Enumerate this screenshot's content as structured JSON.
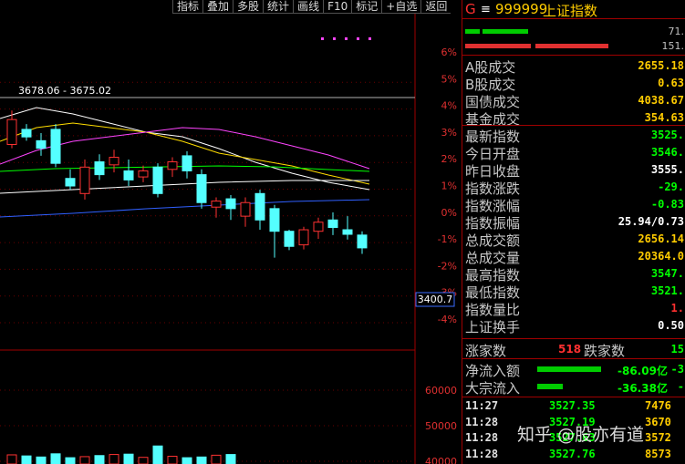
{
  "toolbar": [
    "指标",
    "叠加",
    "多股",
    "统计",
    "画线",
    "F10",
    "标记",
    "+自选",
    "返回"
  ],
  "chart": {
    "pct_axis": [
      "6%",
      "5%",
      "4%",
      "3%",
      "2%",
      "1%",
      "0%",
      "-1%",
      "-2%",
      "-3%",
      "-4%"
    ],
    "vol_axis": [
      "60000",
      "50000",
      "40000"
    ],
    "price_label": "3678.06 - 3675.02",
    "cursor_price": "3400.7",
    "candles": [
      {
        "o": 3645,
        "c": 3678,
        "h": 3690,
        "l": 3640
      },
      {
        "o": 3665,
        "c": 3655,
        "h": 3672,
        "l": 3650
      },
      {
        "o": 3650,
        "c": 3640,
        "h": 3660,
        "l": 3630
      },
      {
        "o": 3665,
        "c": 3620,
        "h": 3672,
        "l": 3615
      },
      {
        "o": 3600,
        "c": 3590,
        "h": 3612,
        "l": 3585
      },
      {
        "o": 3580,
        "c": 3615,
        "h": 3625,
        "l": 3572
      },
      {
        "o": 3622,
        "c": 3605,
        "h": 3632,
        "l": 3598
      },
      {
        "o": 3618,
        "c": 3628,
        "h": 3638,
        "l": 3608
      },
      {
        "o": 3610,
        "c": 3598,
        "h": 3625,
        "l": 3590
      },
      {
        "o": 3602,
        "c": 3610,
        "h": 3617,
        "l": 3595
      },
      {
        "o": 3615,
        "c": 3580,
        "h": 3620,
        "l": 3575
      },
      {
        "o": 3612,
        "c": 3622,
        "h": 3628,
        "l": 3602
      },
      {
        "o": 3630,
        "c": 3610,
        "h": 3636,
        "l": 3600
      },
      {
        "o": 3605,
        "c": 3568,
        "h": 3612,
        "l": 3560
      },
      {
        "o": 3562,
        "c": 3570,
        "h": 3575,
        "l": 3548
      },
      {
        "o": 3573,
        "c": 3560,
        "h": 3578,
        "l": 3545
      },
      {
        "o": 3550,
        "c": 3568,
        "h": 3575,
        "l": 3536
      },
      {
        "o": 3580,
        "c": 3545,
        "h": 3585,
        "l": 3532
      },
      {
        "o": 3560,
        "c": 3530,
        "h": 3565,
        "l": 3495
      },
      {
        "o": 3530,
        "c": 3510,
        "h": 3532,
        "l": 3505
      },
      {
        "o": 3512,
        "c": 3532,
        "h": 3536,
        "l": 3506
      },
      {
        "o": 3530,
        "c": 3542,
        "h": 3548,
        "l": 3520
      },
      {
        "o": 3545,
        "c": 3535,
        "h": 3555,
        "l": 3525
      },
      {
        "o": 3532,
        "c": 3526,
        "h": 3550,
        "l": 3519
      },
      {
        "o": 3525,
        "c": 3508,
        "h": 3530,
        "l": 3500
      }
    ],
    "vol_bars": [
      41800,
      41500,
      41200,
      42100,
      41000,
      41300,
      41600,
      41900,
      42000,
      41100,
      44300,
      41400,
      41000,
      41200,
      41700,
      41900
    ]
  },
  "panel": {
    "title_prefix": "G",
    "code": "999999",
    "name": "上证指数",
    "ratio_top": "71.",
    "ratio_bottom": "151.",
    "rows": [
      {
        "label": "A股成交",
        "value": "2655.18",
        "color": "#ffcc00"
      },
      {
        "label": "B股成交",
        "value": "0.63",
        "color": "#ffcc00"
      },
      {
        "label": "国债成交",
        "value": "4038.67",
        "color": "#ffcc00"
      },
      {
        "label": "基金成交",
        "value": "354.63",
        "color": "#ffcc00"
      },
      {
        "label": "最新指数",
        "value": "3525.",
        "color": "#00ff00"
      },
      {
        "label": "今日开盘",
        "value": "3546.",
        "color": "#00ff00"
      },
      {
        "label": "昨日收盘",
        "value": "3555.",
        "color": "#ffffff"
      },
      {
        "label": "指数涨跌",
        "value": "-29.",
        "color": "#00ff00"
      },
      {
        "label": "指数涨幅",
        "value": "-0.83",
        "color": "#00ff00"
      },
      {
        "label": "指数振幅",
        "value": "25.94/0.73",
        "color": "#ffffff"
      },
      {
        "label": "总成交额",
        "value": "2656.14",
        "color": "#ffcc00"
      },
      {
        "label": "总成交量",
        "value": "20364.0",
        "color": "#ffcc00"
      },
      {
        "label": "最高指数",
        "value": "3547.",
        "color": "#00ff00"
      },
      {
        "label": "最低指数",
        "value": "3521.",
        "color": "#00ff00"
      },
      {
        "label": "指数量比",
        "value": "1.",
        "color": "#ff3030"
      },
      {
        "label": "上证换手",
        "value": "0.50",
        "color": "#ffffff"
      }
    ],
    "up_label": "涨家数",
    "up_value": "518",
    "down_label": "跌家数",
    "down_value": "15",
    "flows": [
      {
        "label": "净流入额",
        "value": "-86.09亿",
        "tail": "-3"
      },
      {
        "label": "大宗流入",
        "value": "-36.38亿",
        "tail": "-"
      }
    ],
    "ticks": [
      {
        "time": "11:27",
        "price": "3527.35",
        "vol": "7476"
      },
      {
        "time": "11:28",
        "price": "3527.19",
        "vol": "3670"
      },
      {
        "time": "11:28",
        "price": "3527.63",
        "vol": "3572"
      },
      {
        "time": "11:28",
        "price": "3527.76",
        "vol": "8573"
      }
    ]
  },
  "watermark": "知乎 @股亦有道",
  "colors": {
    "up": "#ff3232",
    "down": "#54ffff",
    "bg": "#000000",
    "frame": "#a00000"
  }
}
